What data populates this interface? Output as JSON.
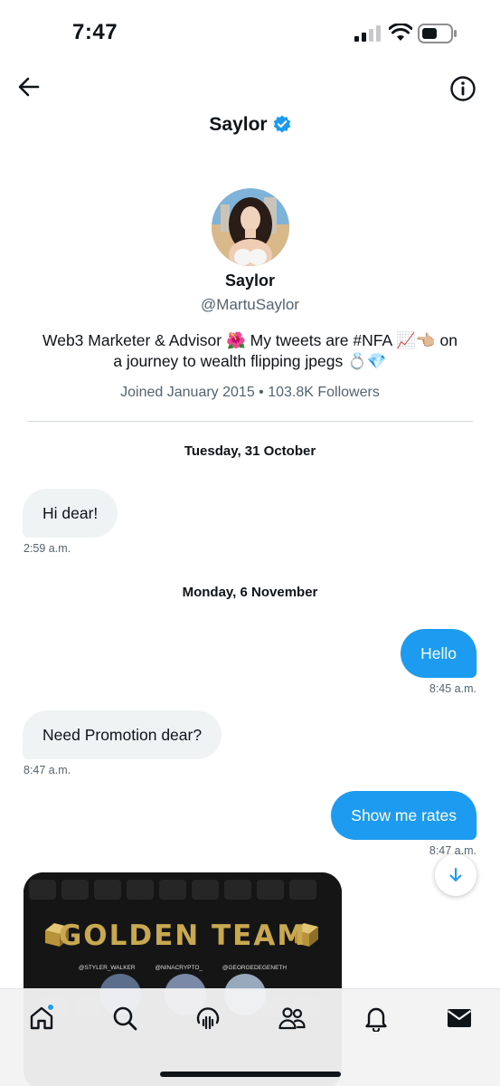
{
  "status_bar": {
    "time": "7:47"
  },
  "header": {
    "title": "Saylor"
  },
  "profile": {
    "name": "Saylor",
    "handle": "@MartuSaylor",
    "bio_line1": "Web3 Marketer & Advisor 🌺 My tweets are #NFA 📈👈🏼 on",
    "bio_line2": "a journey to wealth flipping jpegs 💍💎",
    "meta": "Joined January 2015 • 103.8K Followers"
  },
  "conversation": {
    "dates": [
      "Tuesday, 31 October",
      "Monday, 6 November"
    ],
    "messages": [
      {
        "direction": "in",
        "text": "Hi dear!",
        "time": "2:59 a.m."
      },
      {
        "direction": "out",
        "text": "Hello",
        "time": "8:45 a.m."
      },
      {
        "direction": "in",
        "text": "Need Promotion dear?",
        "time": "8:47 a.m."
      },
      {
        "direction": "out",
        "text": "Show me rates",
        "time": "8:47 a.m."
      }
    ]
  },
  "media_card": {
    "title": "GOLDEN TEAM",
    "handles": [
      "@STYLER_WALKER",
      "@NINACRYPTO_",
      "@GEORGEDEGENETH"
    ]
  },
  "tab_bar": {
    "tabs": [
      "home-icon",
      "search-icon",
      "spaces-icon",
      "communities-icon",
      "notifications-icon",
      "messages-icon"
    ],
    "home_has_notification": true
  },
  "colors": {
    "accent": "#1d9bf0",
    "incoming_bubble": "#eff3f4",
    "secondary_text": "#536471",
    "gold": "#c8a850"
  }
}
